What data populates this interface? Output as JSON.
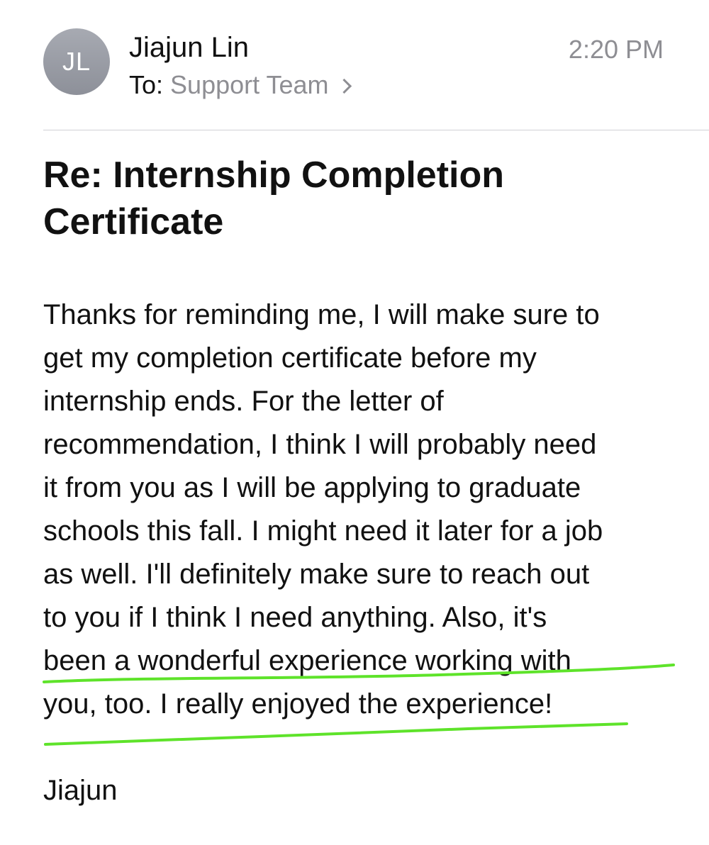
{
  "header": {
    "avatar_initials": "JL",
    "sender_name": "Jiajun Lin",
    "to_label": "To:",
    "recipient": "Support Team",
    "timestamp": "2:20 PM"
  },
  "message": {
    "subject": "Re: Internship Completion Certificate",
    "body_lines": [
      "Thanks for reminding me, I will make sure to",
      "get my completion certificate before my",
      "internship ends. For the letter of",
      "recommendation, I think I will probably need",
      "it from you as I will be applying to graduate",
      "schools this fall. I might need it later for a job",
      "as well. I'll definitely make sure to reach out",
      "to you if I think I need anything. Also, it's",
      "been a wonderful experience working with",
      "you, too. I really enjoyed the experience!"
    ],
    "signature": "Jiajun"
  },
  "annotation": {
    "highlight_color": "#5ee32a",
    "highlighted_lines": [
      8,
      9
    ]
  },
  "colors": {
    "secondary_text": "#8e8e93",
    "avatar": "#9a9da5"
  }
}
